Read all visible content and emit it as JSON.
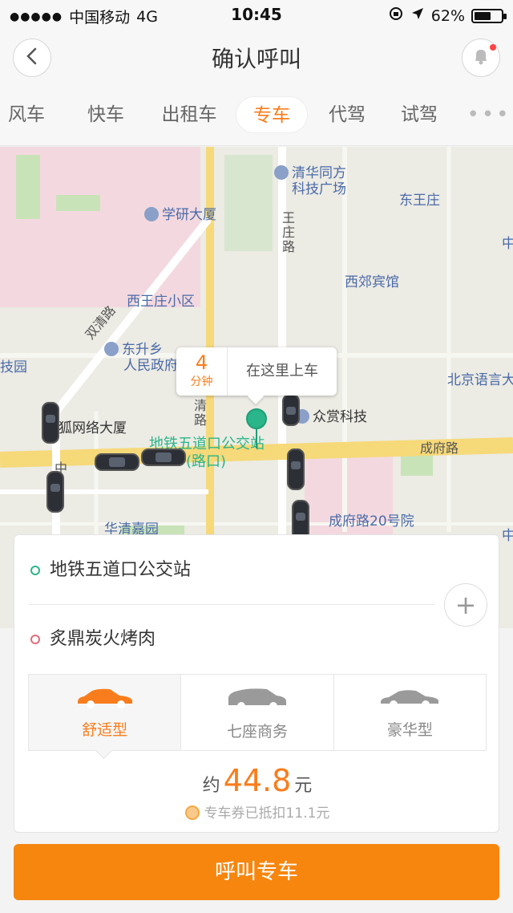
{
  "status_bar": {
    "signal_dots": "●●●●●",
    "carrier": "中国移动",
    "network": "4G",
    "time": "10:45",
    "battery": "62%",
    "battery_level": 0.62
  },
  "header": {
    "title": "确认呼叫"
  },
  "tabs": [
    {
      "label": "风车"
    },
    {
      "label": "快车"
    },
    {
      "label": "出租车"
    },
    {
      "label": "专车",
      "active": true
    },
    {
      "label": "代驾"
    },
    {
      "label": "试驾"
    },
    {
      "label": "•••"
    }
  ],
  "map": {
    "labels": {
      "qinghua_tongfang": "清华同方",
      "keji_guangchang": "科技广场",
      "dongwangzhuang": "东王庄",
      "xueyan_dasha": "学研大厦",
      "wangzhuang_lu": "王庄路",
      "xijiao_binguan": "西郊宾馆",
      "xiwangzhuang_xiaoqu": "西王庄小区",
      "shuangqing_lu": "双清路",
      "dongsheng_xiang": "东升乡",
      "renmin_zhengfu": "人民政府",
      "beijing_yuyan": "北京语言大",
      "ji_yuan": "技园",
      "sohu_dasha": "搜狐网络大厦",
      "zhongshang_keji": "众赏科技",
      "qing_lu": "清路",
      "chengfu_lu": "成府路",
      "wudaokou_station": "地铁五道口公交站",
      "wudaokou_line2": "(路口)",
      "chengfu_20": "成府路20号院",
      "huaqing_jiayuan": "华清嘉园",
      "zhong_jing": "中",
      "zhong_east": "中",
      "zhong_right": "中"
    },
    "callout": {
      "eta_value": "4",
      "eta_unit": "分钟",
      "message": "在这里上车"
    }
  },
  "panel": {
    "origin": "地铁五道口公交站",
    "destination": "炙鼎炭火烤肉",
    "add_label": "+",
    "car_types": [
      {
        "label": "舒适型",
        "selected": true,
        "color": "#f97d1c"
      },
      {
        "label": "七座商务",
        "selected": false,
        "color": "#9a9a9a"
      },
      {
        "label": "豪华型",
        "selected": false,
        "color": "#9a9a9a"
      }
    ],
    "price_prefix": "约",
    "price_value": "44.8",
    "price_unit": "元",
    "coupon_text": "专车券已抵扣11.1元"
  },
  "call_button": {
    "label": "呼叫专车"
  },
  "colors": {
    "accent": "#f97d1c",
    "button": "#f7860f",
    "pin": "#2bb58a"
  }
}
